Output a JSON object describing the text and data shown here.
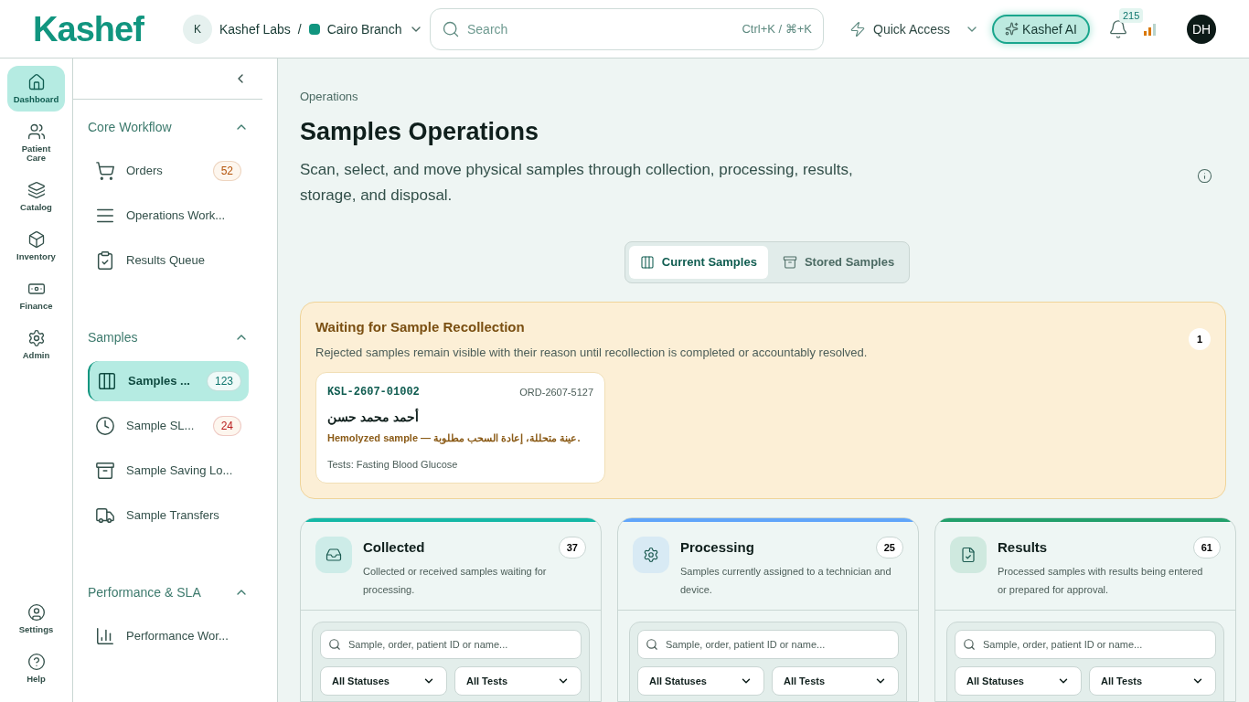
{
  "header": {
    "logo": "Kashef",
    "org_initial": "K",
    "org": "Kashef Labs",
    "separator": "/",
    "branch": "Cairo Branch",
    "search": {
      "placeholder": "Search",
      "shortcut": "Ctrl+K / ⌘+K"
    },
    "quick_access": "Quick Access",
    "ai_button": "Kashef AI",
    "notifications": "215",
    "user_initials": "DH"
  },
  "rail": {
    "top": [
      {
        "label": "Dashboard",
        "kind": "home",
        "selected": true
      },
      {
        "label": "Patient Care",
        "kind": "users",
        "selected": false
      },
      {
        "label": "Catalog",
        "kind": "layers",
        "selected": false
      },
      {
        "label": "Inventory",
        "kind": "box",
        "selected": false
      },
      {
        "label": "Finance",
        "kind": "banknote",
        "selected": false
      },
      {
        "label": "Admin",
        "kind": "gear",
        "selected": false
      }
    ],
    "bottom": [
      {
        "label": "Settings",
        "kind": "user",
        "selected": false
      },
      {
        "label": "Help",
        "kind": "help",
        "selected": false
      }
    ]
  },
  "nav": {
    "sections": [
      {
        "title": "Core Workflow",
        "expanded": true,
        "items": [
          {
            "label": "Orders",
            "kind": "cart",
            "badge": "52",
            "color": "#b45309",
            "selected": false
          },
          {
            "label": "Operations Work...",
            "kind": "rows",
            "selected": false
          },
          {
            "label": "Results Queue",
            "kind": "clipboard",
            "selected": false
          }
        ]
      },
      {
        "title": "Samples",
        "expanded": true,
        "items": [
          {
            "label": "Samples ...",
            "kind": "columns",
            "badge": "123",
            "color": "#0f766e",
            "selected": true
          },
          {
            "label": "Sample SL...",
            "kind": "clock",
            "badge": "24",
            "color": "#b91c1c",
            "selected": false
          },
          {
            "label": "Sample Saving Lo...",
            "kind": "archive",
            "selected": false
          },
          {
            "label": "Sample Transfers",
            "kind": "truck",
            "selected": false
          }
        ]
      },
      {
        "title": "Performance & SLA",
        "expanded": true,
        "items": [
          {
            "label": "Performance Wor...",
            "kind": "chart",
            "selected": false
          }
        ]
      }
    ]
  },
  "page": {
    "breadcrumb": "Operations",
    "title": "Samples Operations",
    "description": "Scan, select, and move physical samples through collection, processing, results, storage, and disposal.",
    "tabs": [
      {
        "label": "Current Samples",
        "kind": "columns",
        "selected": true
      },
      {
        "label": "Stored Samples",
        "kind": "archive",
        "selected": false
      }
    ],
    "recollection": {
      "title": "Waiting for Sample Recollection",
      "description": "Rejected samples remain visible with their reason until recollection is completed or accountably resolved.",
      "count": "1",
      "samples": [
        {
          "sample_id": "KSL-2607-01002",
          "order_id": "ORD-2607-5127",
          "patient": "أحمد محمد حسن",
          "reason": "Hemolyzed sample — عينة متحللة، إعادة السحب مطلوبة.",
          "tests": "Tests: Fasting Blood Glucose"
        }
      ]
    },
    "columns": [
      {
        "title": "Collected",
        "description": "Collected or received samples waiting for processing.",
        "count": "37",
        "color": "#14b8a6",
        "kind": "inbox",
        "search_placeholder": "Sample, order, patient ID or name...",
        "filters": [
          "All Statuses",
          "All Tests"
        ]
      },
      {
        "title": "Processing",
        "description": "Samples currently assigned to a technician and device.",
        "count": "25",
        "color": "#60a5fa",
        "kind": "gear",
        "search_placeholder": "Sample, order, patient ID or name...",
        "filters": [
          "All Statuses",
          "All Tests"
        ]
      },
      {
        "title": "Results",
        "description": "Processed samples with results being entered or prepared for approval.",
        "count": "61",
        "color": "#22a06b",
        "kind": "filecheck",
        "search_placeholder": "Sample, order, patient ID or name...",
        "filters": [
          "All Statuses",
          "All Tests"
        ]
      }
    ]
  }
}
